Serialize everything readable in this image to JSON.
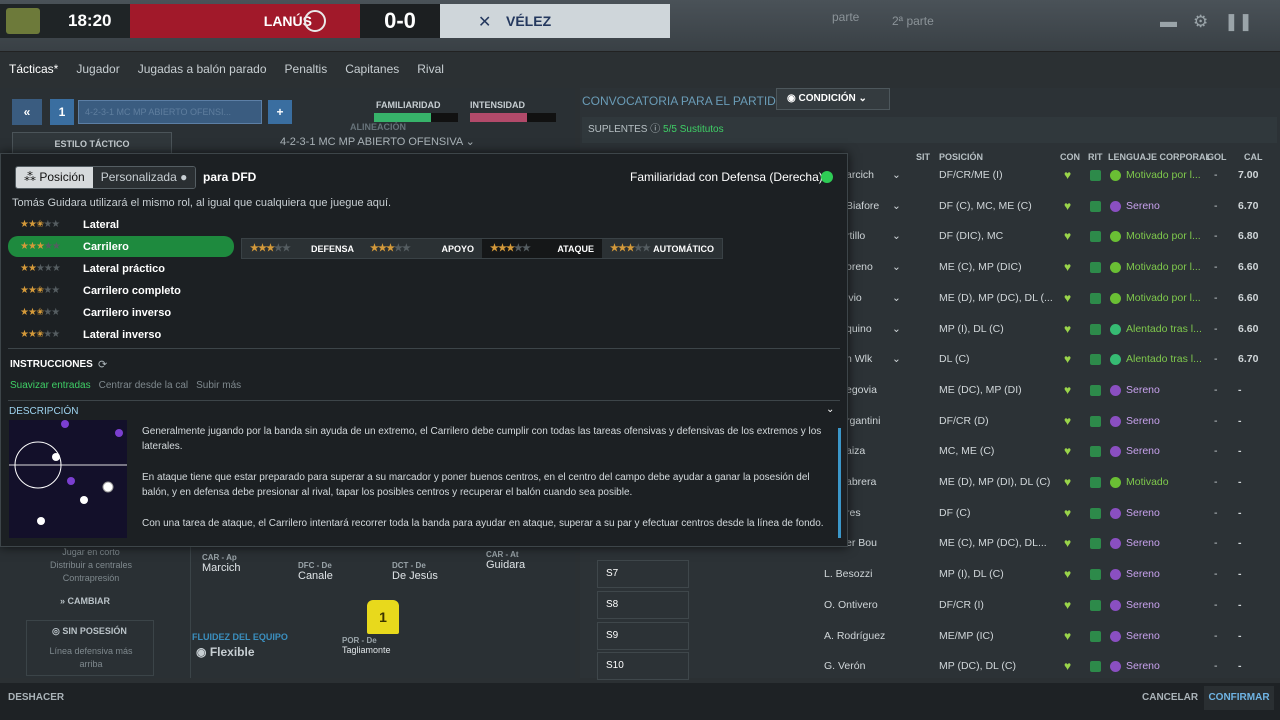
{
  "header": {
    "time": "18:20",
    "home_team": "LANÚS",
    "score": "0-0",
    "away_team": "VÉLEZ",
    "half1": "parte",
    "half2": "2ª parte"
  },
  "tabs": [
    "Tácticas*",
    "Jugador",
    "Jugadas a balón parado",
    "Penaltis",
    "Capitanes",
    "Rival"
  ],
  "tactics": {
    "nav_back": "«",
    "slot": "1",
    "formation_box": "4-2-3-1 MC MP ABIERTO OFENSI...",
    "add": "+",
    "style_label": "ESTILO TÁCTICO",
    "familiarity": "FAMILIARIDAD",
    "intensity": "INTENSIDAD",
    "alineacion": "ALINEACIÓN",
    "formation": "4-2-3-1 MC MP ABIERTO OFENSIVA"
  },
  "popup": {
    "tab_position": "Posición",
    "tab_custom": "Personalizada",
    "for": "para DFD",
    "familiarity": "Familiaridad con Defensa (Derecha):",
    "note": "Tomás Guidara utilizará el mismo rol, al igual que cualquiera que juegue aquí.",
    "roles": [
      {
        "label": "Lateral",
        "stars": 2.5
      },
      {
        "label": "Carrilero",
        "stars": 3
      },
      {
        "label": "Lateral práctico",
        "stars": 2
      },
      {
        "label": "Carrilero completo",
        "stars": 2.5
      },
      {
        "label": "Carrilero inverso",
        "stars": 2.5
      },
      {
        "label": "Lateral inverso",
        "stars": 2.5
      }
    ],
    "duties": [
      {
        "label": "DEFENSA",
        "stars": 3
      },
      {
        "label": "APOYO",
        "stars": 3
      },
      {
        "label": "ATAQUE",
        "stars": 3
      },
      {
        "label": "AUTOMÁTICO",
        "stars": 3
      }
    ],
    "instr_title": "INSTRUCCIONES",
    "instructions": [
      "Suavizar entradas",
      "Centrar desde la cal",
      "Subir más"
    ],
    "desc_title": "DESCRIPCIÓN",
    "desc": [
      "Generalmente jugando por la banda sin ayuda de un extremo, el Carrilero debe cumplir con todas las tareas ofensivas y defensivas de los extremos y los laterales.",
      "En ataque tiene que estar preparado para superar a su marcador y poner buenos centros, en el centro del campo debe ayudar a ganar la posesión del balón, y en defensa debe presionar al rival, tapar los posibles centros y recuperar el balón cuando sea posible.",
      "Con una tarea de ataque, el Carrilero intentará recorrer toda la banda para ayudar en ataque, superar a su par y efectuar centros desde la línea de fondo."
    ]
  },
  "squad": {
    "title": "CONVOCATORIA PARA EL PARTIDO",
    "condition": "CONDICIÓN",
    "subs_label": "SUPLENTES",
    "subs_count": "5/5 Sustitutos",
    "headers": {
      "sit": "SIT",
      "pos": "POSICIÓN",
      "con": "CON",
      "rit": "RIT",
      "body": "LENGUAJE CORPORAL",
      "gol": "GOL",
      "cal": "CAL"
    },
    "rows": [
      {
        "name": "arcich",
        "pos": "DF/CR/ME (I)",
        "body": "Motivado por l...",
        "gol": "-",
        "cal": "7.00"
      },
      {
        "name": "Biafore",
        "pos": "DF (C), MC, ME (C)",
        "body": "Sereno",
        "gol": "-",
        "cal": "6.70"
      },
      {
        "name": "rtillo",
        "pos": "DF (DIC), MC",
        "body": "Motivado por l...",
        "gol": "-",
        "cal": "6.80"
      },
      {
        "name": "oreno",
        "pos": "ME (C), MP (DIC)",
        "body": "Motivado por l...",
        "gol": "-",
        "cal": "6.60"
      },
      {
        "name": "lvio",
        "pos": "ME (D), MP (DC), DL (...",
        "body": "Motivado por l...",
        "gol": "-",
        "cal": "6.60"
      },
      {
        "name": "quino",
        "pos": "MP (I), DL (C)",
        "body": "Alentado tras l...",
        "gol": "-",
        "cal": "6.60"
      },
      {
        "name": "n Wlk",
        "pos": "DL (C)",
        "body": "Alentado tras l...",
        "gol": "-",
        "cal": "6.70"
      },
      {
        "name": "egovia",
        "pos": "ME (DC), MP (DI)",
        "body": "Sereno",
        "gol": "-",
        "cal": "-"
      },
      {
        "name": "rgantini",
        "pos": "DF/CR (D)",
        "body": "Sereno",
        "gol": "-",
        "cal": "-"
      },
      {
        "name": "aiza",
        "pos": "MC, ME (C)",
        "body": "Sereno",
        "gol": "-",
        "cal": "-"
      },
      {
        "name": "abrera",
        "pos": "ME (D), MP (DI), DL (C)",
        "body": "Motivado",
        "gol": "-",
        "cal": "-"
      },
      {
        "name": "res",
        "pos": "DF (C)",
        "body": "Sereno",
        "gol": "-",
        "cal": "-"
      },
      {
        "name": "er Bou",
        "pos": "ME (C), MP (DC), DL...",
        "body": "Sereno",
        "gol": "-",
        "cal": "-"
      },
      {
        "name": "L. Besozzi",
        "pos": "MP (I), DL (C)",
        "body": "Sereno",
        "gol": "-",
        "cal": "-",
        "slot": "S7"
      },
      {
        "name": "O. Ontivero",
        "pos": "DF/CR (I)",
        "body": "Sereno",
        "gol": "-",
        "cal": "-",
        "slot": "S8"
      },
      {
        "name": "A. Rodríguez",
        "pos": "ME/MP (IC)",
        "body": "Sereno",
        "gol": "-",
        "cal": "-",
        "slot": "S9"
      },
      {
        "name": "G. Verón",
        "pos": "MP (DC), DL (C)",
        "body": "Sereno",
        "gol": "-",
        "cal": "-",
        "slot": "S10"
      }
    ]
  },
  "pitch": {
    "car_ap": "CAR - Ap",
    "marcich": "Marcich",
    "dfc": "DFC - De",
    "canale": "Canale",
    "dct": "DCT - De",
    "dejesus": "De Jesús",
    "car_at": "CAR - At",
    "guidara": "Guidara",
    "por": "POR - De",
    "tagliamonte": "Tagliamonte",
    "gk_num": "1",
    "fluidez": "FLUIDEZ DEL EQUIPO",
    "flex": "Flexible"
  },
  "leftpanel": {
    "l1": "Jugar en corto",
    "l2": "Distribuir a centrales",
    "l3": "Contrapresión",
    "cambiar": "CAMBIAR",
    "sinpos": "SIN POSESIÓN",
    "l4": "Línea defensiva más",
    "l5": "arriba"
  },
  "footer": {
    "undo": "DESHACER",
    "cancel": "CANCELAR",
    "confirm": "CONFIRMAR"
  }
}
